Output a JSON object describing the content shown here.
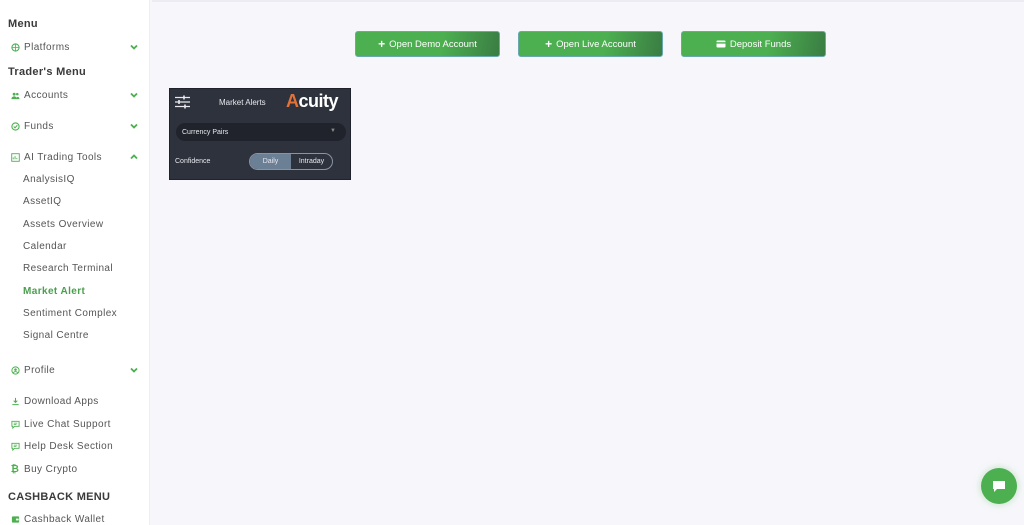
{
  "sidebar": {
    "menu_title": "Menu",
    "platforms": "Platforms",
    "traders_menu_title": "Trader's Menu",
    "accounts": "Accounts",
    "funds": "Funds",
    "ai_trading_tools": "AI Trading Tools",
    "ai_sub_items": [
      {
        "label": "AnalysisIQ"
      },
      {
        "label": "AssetIQ"
      },
      {
        "label": "Assets Overview"
      },
      {
        "label": "Calendar"
      },
      {
        "label": "Research Terminal"
      },
      {
        "label": "Market Alert",
        "active": true
      },
      {
        "label": "Sentiment Complex"
      },
      {
        "label": "Signal Centre"
      }
    ],
    "profile": "Profile",
    "download_apps": "Download Apps",
    "live_chat_support": "Live Chat Support",
    "help_desk_section": "Help Desk Section",
    "buy_crypto": "Buy Crypto",
    "cashback_menu_title": "CASHBACK MENU",
    "cashback_wallet": "Cashback Wallet"
  },
  "actions": {
    "open_demo": "Open Demo Account",
    "open_live": "Open Live Account",
    "deposit": "Deposit Funds"
  },
  "widget": {
    "title": "Market Alerts",
    "brand": "cuity",
    "brand_prefix": "A",
    "select_value": "Currency Pairs",
    "confidence_label": "Confidence",
    "toggle_options": [
      "Daily",
      "Intraday"
    ],
    "toggle_selected": "Daily"
  },
  "colors": {
    "accent": "#4caf50",
    "active_text": "#4a9e4e",
    "widget_bg": "#2e323c"
  }
}
